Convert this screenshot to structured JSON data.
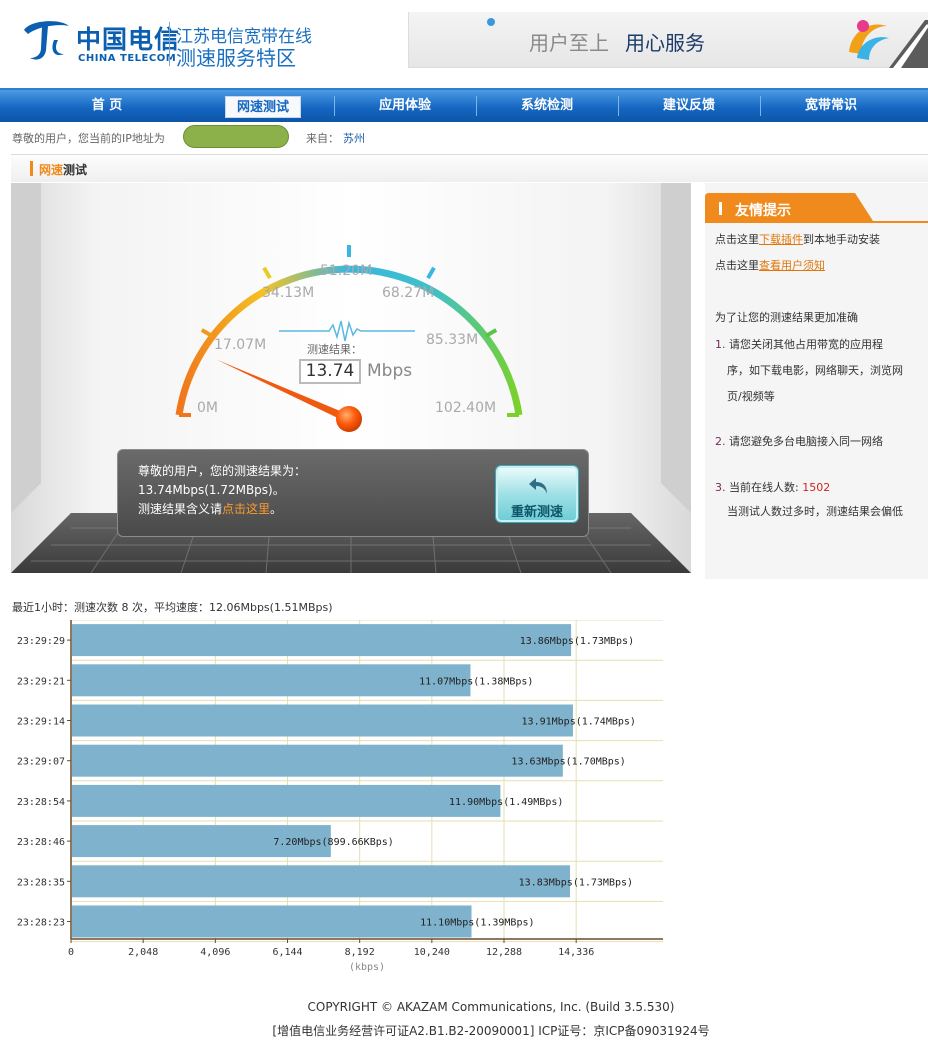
{
  "header": {
    "logo_cn": "中国电信",
    "logo_en": "CHINA TELECOM",
    "site_title_line1": "江苏电信宽带在线",
    "site_title_line2": "测速服务特区",
    "slogan_part1": "用户至上",
    "slogan_part2": "用心服务"
  },
  "nav": {
    "items": [
      {
        "label": "首    页"
      },
      {
        "label": "网速测试"
      },
      {
        "label": "应用体验"
      },
      {
        "label": "系统检测"
      },
      {
        "label": "建议反馈"
      },
      {
        "label": "宽带常识"
      }
    ]
  },
  "ip_row": {
    "label": "尊敬的用户，您当前的IP地址为",
    "from_label": "来自：",
    "city": "苏州"
  },
  "section": {
    "title_hl": "网速",
    "title_rest": "测试"
  },
  "gauge": {
    "tick_labels": [
      "0M",
      "17.07M",
      "34.13M",
      "51.20M",
      "68.27M",
      "85.33M",
      "102.40M"
    ],
    "max": 102.4,
    "value": 13.74,
    "result_caption": "测速结果：",
    "result_value": "13.74",
    "result_unit": "Mbps"
  },
  "message": {
    "line1": "尊敬的用户，您的测速结果为：",
    "line2": "13.74Mbps(1.72MBps)。",
    "line3_prefix": "测速结果含义请",
    "line3_link": "点击这里",
    "line3_suffix": "。",
    "retest_label": "重新测速"
  },
  "tips": {
    "title": "友情提示",
    "t1_prefix": "点击这里",
    "t1_link": "下载插件",
    "t1_suffix": "到本地手动安装",
    "t2_prefix": "点击这里",
    "t2_link": "查看用户须知",
    "t3": "为了让您的测速结果更加准确",
    "t4_num": "1.",
    "t4_a": "请您关闭其他占用带宽的应用程",
    "t4_b": "序，如下载电影，网络聊天，浏览网",
    "t4_c": "页/视频等",
    "t5_num": "2.",
    "t5": "请您避免多台电脑接入同一网络",
    "t6_num": "3.",
    "t6_prefix": "当前在线人数:",
    "t6_count": "1502",
    "t7": "当测试人数过多时，测速结果会偏低"
  },
  "chart_summary": "最近1小时：测速次数 8 次，平均速度：12.06Mbps(1.51MBps)",
  "chart_data": {
    "type": "bar",
    "orientation": "horizontal",
    "categories": [
      "23:29:29",
      "23:29:21",
      "23:29:14",
      "23:29:07",
      "23:28:54",
      "23:28:46",
      "23:28:35",
      "23:28:23"
    ],
    "values": [
      14192,
      11336,
      14244,
      13957,
      12186,
      7373,
      14162,
      11366
    ],
    "data_labels": [
      "13.86Mbps(1.73MBps)",
      "11.07Mbps(1.38MBps)",
      "13.91Mbps(1.74MBps)",
      "13.63Mbps(1.70MBps)",
      "11.90Mbps(1.49MBps)",
      "7.20Mbps(899.66KBps)",
      "13.83Mbps(1.73MBps)",
      "11.10Mbps(1.39MBps)"
    ],
    "x_ticks": [
      0,
      2048,
      4096,
      6144,
      8192,
      10240,
      12288,
      14336
    ],
    "x_tick_labels": [
      "0",
      "2,048",
      "4,096",
      "6,144",
      "8,192",
      "10,240",
      "12,288",
      "14,336"
    ],
    "xlim": [
      0,
      16800
    ],
    "xlabel": "(kbps)",
    "grid": true,
    "bar_color": "#7fb2cc"
  },
  "footer": {
    "line1": "COPYRIGHT © AKAZAM Communications, Inc. (Build 3.5.530)",
    "line2": "[增值电信业务经营许可证A2.B1.B2-20090001] ICP证号：京ICP备09031924号"
  }
}
